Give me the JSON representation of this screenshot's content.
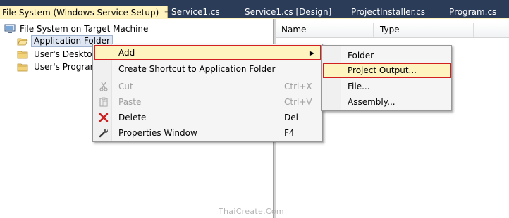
{
  "tabs": {
    "active": "File System (Windows Service Setup)",
    "others": [
      "Service1.cs",
      "Service1.cs [Design]",
      "ProjectInstaller.cs",
      "Program.cs"
    ]
  },
  "tree": {
    "root": "File System on Target Machine",
    "items": [
      "Application Folder",
      "User's Desktop",
      "User's Programs Menu"
    ]
  },
  "list": {
    "columns": [
      "Name",
      "Type"
    ]
  },
  "context_menu": {
    "items": [
      {
        "label": "Add",
        "shortcut": "",
        "icon": "none",
        "state": "highlighted",
        "submenu": true
      },
      {
        "label": "Create Shortcut to Application Folder",
        "shortcut": "",
        "icon": "none"
      },
      {
        "label": "Cut",
        "shortcut": "Ctrl+X",
        "icon": "scissors-icon",
        "state": "disabled"
      },
      {
        "label": "Paste",
        "shortcut": "Ctrl+V",
        "icon": "paste-icon",
        "state": "disabled"
      },
      {
        "label": "Delete",
        "shortcut": "Del",
        "icon": "delete-x-icon"
      },
      {
        "label": "Properties Window",
        "shortcut": "F4",
        "icon": "wrench-icon"
      }
    ]
  },
  "submenu": {
    "items": [
      "Folder",
      "Project Output...",
      "File...",
      "Assembly..."
    ],
    "highlighted": "Project Output..."
  },
  "watermark": "ThaiCreate.Com",
  "colors": {
    "tabstrip_bg": "#2b3c59",
    "active_tab_bg": "#fff4bf",
    "highlight_outline": "#d21f1f",
    "delete_icon": "#cc1f1f"
  }
}
